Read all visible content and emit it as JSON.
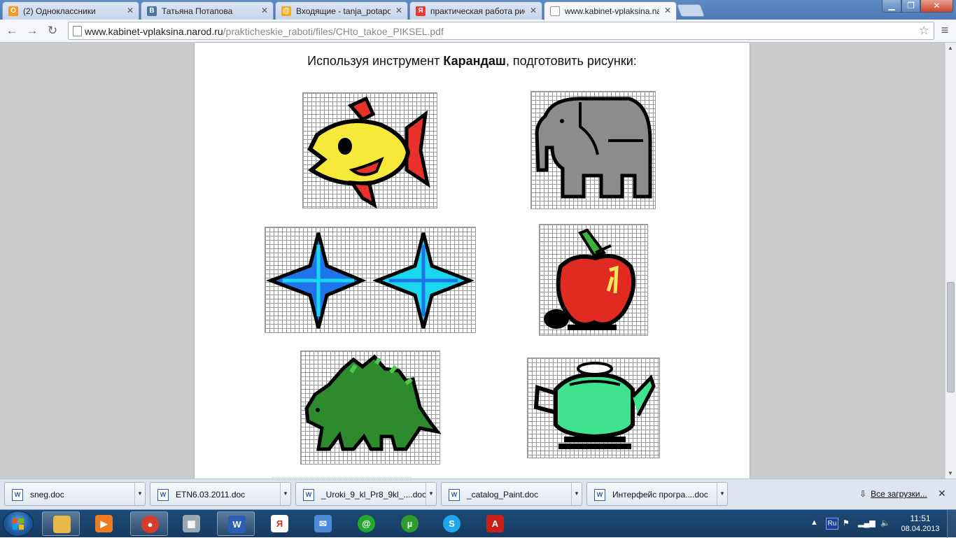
{
  "tabs": [
    {
      "title": "(2) Одноклассники",
      "favicon": "odnoklassniki-icon",
      "color": "#f59a23",
      "glyph": "О"
    },
    {
      "title": "Татьяна Потапова",
      "favicon": "vk-icon",
      "color": "#4c75a3",
      "glyph": "В"
    },
    {
      "title": "Входящие - tanja_potapov",
      "favicon": "mail-ru-icon",
      "color": "#f5a623",
      "glyph": "@"
    },
    {
      "title": "практическая работа рис",
      "favicon": "yandex-icon",
      "color": "#e83b2f",
      "glyph": "Я"
    },
    {
      "title": "www.kabinet-vplaksina.na",
      "favicon": "page-icon",
      "color": "#ffffff",
      "glyph": ""
    }
  ],
  "address": {
    "domain": "www.kabinet-vplaksina.narod.ru",
    "path": "/prakticheskie_raboti/files/CHto_takoe_PIKSEL.pdf"
  },
  "document": {
    "instruction_before": "Используя инструмент ",
    "instruction_bold": "Карандаш",
    "instruction_after": ", подготовить рисунки:",
    "pictures": [
      {
        "name": "fish-picture",
        "colors": [
          "#f7e93a",
          "#e8312a",
          "#000000"
        ]
      },
      {
        "name": "elephant-picture",
        "colors": [
          "#8c8c8c",
          "#000000"
        ]
      },
      {
        "name": "stars-picture",
        "colors": [
          "#1e74e8",
          "#1ad7f0",
          "#000000"
        ]
      },
      {
        "name": "apple-picture",
        "colors": [
          "#e02a22",
          "#3cb23c",
          "#f4e55a",
          "#000000"
        ]
      },
      {
        "name": "dinosaur-picture",
        "colors": [
          "#2d8b2d",
          "#4ec94e",
          "#000000"
        ]
      },
      {
        "name": "teapot-picture",
        "colors": [
          "#3ee28f",
          "#000000"
        ]
      }
    ]
  },
  "downloads": [
    {
      "name": "sneg.doc"
    },
    {
      "name": "ETN6.03.2011.doc"
    },
    {
      "name": "_Uroki_9_kl_Pr8_9kl_....doc"
    },
    {
      "name": "_catalog_Paint.doc"
    },
    {
      "name": "Интерфейс програ....doc"
    }
  ],
  "downloads_all": "Все загрузки...",
  "taskbar": {
    "apps": [
      {
        "name": "explorer-icon",
        "color": "#e7b94a",
        "glyph": ""
      },
      {
        "name": "media-player-icon",
        "color": "#f07b1e",
        "glyph": "▶"
      },
      {
        "name": "chrome-icon",
        "color": "#d93b2b",
        "glyph": "●"
      },
      {
        "name": "calculator-icon",
        "color": "#9aa8b6",
        "glyph": "▦"
      },
      {
        "name": "word-icon",
        "color": "#2b5fb3",
        "glyph": "W"
      },
      {
        "name": "yandex-browser-icon",
        "color": "#ffffff",
        "glyph": "Я"
      },
      {
        "name": "mail-icon",
        "color": "#4a8ad9",
        "glyph": "✉"
      },
      {
        "name": "mail-agent-icon",
        "color": "#22a832",
        "glyph": "@"
      },
      {
        "name": "utorrent-icon",
        "color": "#2e9d2e",
        "glyph": "µ"
      },
      {
        "name": "skype-icon",
        "color": "#1ca8ea",
        "glyph": "S"
      },
      {
        "name": "acrobat-icon",
        "color": "#c8211b",
        "glyph": "A"
      }
    ],
    "language": "Ru",
    "time": "11:51",
    "date": "08.04.2013"
  }
}
